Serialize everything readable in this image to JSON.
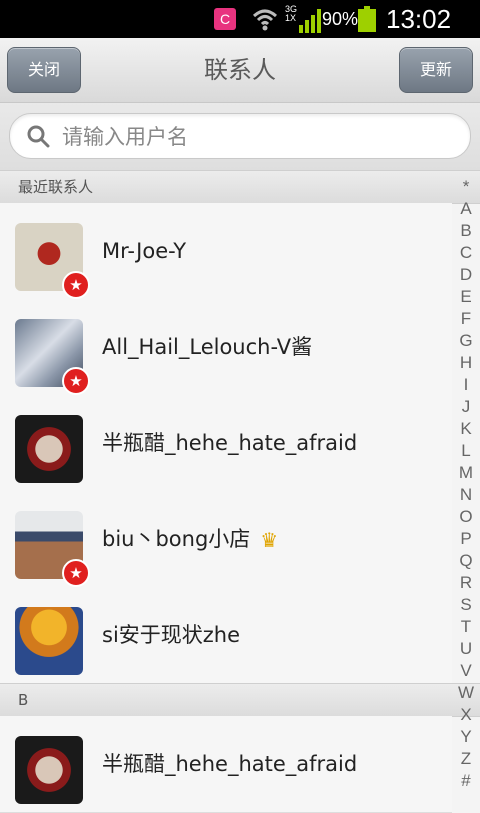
{
  "status_bar": {
    "app_icon_letter": "C",
    "network": "3G 1X",
    "battery_percent": "90%",
    "time": "13:02"
  },
  "header": {
    "close_label": "关闭",
    "title": "联系人",
    "update_label": "更新"
  },
  "search": {
    "placeholder": "请输入用户名",
    "value": ""
  },
  "sections": [
    {
      "label": "最近联系人",
      "contacts": [
        {
          "name": "Mr-Joe-Y",
          "badge": true,
          "crown": false
        },
        {
          "name": "All_Hail_Lelouch-V酱",
          "badge": true,
          "crown": false
        },
        {
          "name": "半瓶醋_hehe_hate_afraid",
          "badge": false,
          "crown": false
        },
        {
          "name": "biu丶bong小店",
          "badge": true,
          "crown": true
        },
        {
          "name": "si安于现状zhe",
          "badge": false,
          "crown": false
        }
      ]
    },
    {
      "label": "B",
      "contacts": [
        {
          "name": "半瓶醋_hehe_hate_afraid",
          "badge": false,
          "crown": false
        }
      ]
    }
  ],
  "alpha_index": [
    "*",
    "A",
    "B",
    "C",
    "D",
    "E",
    "F",
    "G",
    "H",
    "I",
    "J",
    "K",
    "L",
    "M",
    "N",
    "O",
    "P",
    "Q",
    "R",
    "S",
    "T",
    "U",
    "V",
    "W",
    "X",
    "Y",
    "Z",
    "#"
  ],
  "colors": {
    "badge_red": "#e0201f",
    "button_gray": "#7d8793",
    "battery_green": "#9ed000"
  }
}
